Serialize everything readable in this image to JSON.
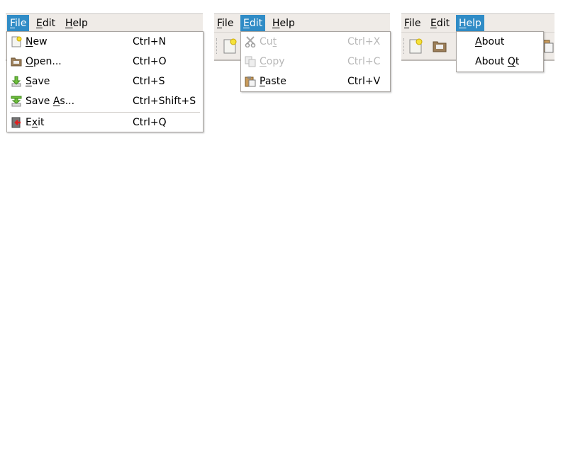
{
  "menubar": [
    {
      "pre": "",
      "u": "F",
      "post": "ile"
    },
    {
      "pre": "",
      "u": "E",
      "post": "dit"
    },
    {
      "pre": "",
      "u": "H",
      "post": "elp"
    }
  ],
  "file_menu": [
    {
      "pre": "",
      "u": "N",
      "post": "ew",
      "shortcut": "Ctrl+N",
      "icon": "new-file-icon"
    },
    {
      "pre": "",
      "u": "O",
      "post": "pen...",
      "shortcut": "Ctrl+O",
      "icon": "open-folder-icon"
    },
    {
      "pre": "",
      "u": "S",
      "post": "ave",
      "shortcut": "Ctrl+S",
      "icon": "save-icon"
    },
    {
      "pre": "Save ",
      "u": "A",
      "post": "s...",
      "shortcut": "Ctrl+Shift+S",
      "icon": "save-as-icon"
    },
    {
      "pre": "E",
      "u": "x",
      "post": "it",
      "shortcut": "Ctrl+Q",
      "icon": "exit-icon"
    }
  ],
  "edit_menu": [
    {
      "pre": "Cu",
      "u": "t",
      "post": "",
      "shortcut": "Ctrl+X",
      "icon": "cut-icon",
      "enabled": false
    },
    {
      "pre": "",
      "u": "C",
      "post": "opy",
      "shortcut": "Ctrl+C",
      "icon": "copy-icon",
      "enabled": false
    },
    {
      "pre": "",
      "u": "P",
      "post": "aste",
      "shortcut": "Ctrl+V",
      "icon": "paste-icon",
      "enabled": true
    }
  ],
  "help_menu": [
    {
      "pre": "",
      "u": "A",
      "post": "bout"
    },
    {
      "pre": "About ",
      "u": "Q",
      "post": "t"
    }
  ],
  "colors": {
    "highlight": "#308cc6",
    "disabled": "#b8b8b8"
  }
}
